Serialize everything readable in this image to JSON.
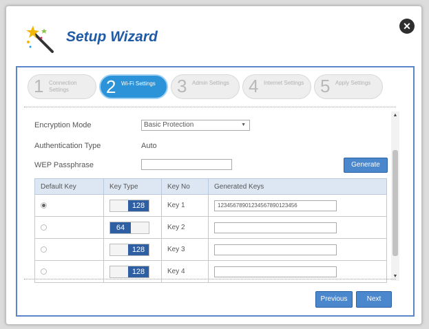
{
  "header": {
    "title": "Setup Wizard",
    "close_symbol": "✕"
  },
  "steps": [
    {
      "num": "1",
      "label": "Connection Settings",
      "active": false
    },
    {
      "num": "2",
      "label": "Wi-Fi Settings",
      "active": true
    },
    {
      "num": "3",
      "label": "Admin Settings",
      "active": false
    },
    {
      "num": "4",
      "label": "Internet Settings",
      "active": false
    },
    {
      "num": "5",
      "label": "Apply Settings",
      "active": false
    }
  ],
  "form": {
    "encryption_label": "Encryption Mode",
    "encryption_value": "Basic Protection",
    "auth_label": "Authentication Type",
    "auth_value": "Auto",
    "wep_label": "WEP Passphrase",
    "generate_label": "Generate"
  },
  "table": {
    "headers": [
      "Default Key",
      "Key Type",
      "Key No",
      "Generated Keys"
    ],
    "rows": [
      {
        "default": true,
        "key_type": "128",
        "key_no": "Key 1",
        "generated": "12345678901234567890123456"
      },
      {
        "default": false,
        "key_type": "64",
        "key_no": "Key 2",
        "generated": ""
      },
      {
        "default": false,
        "key_type": "128",
        "key_no": "Key 3",
        "generated": ""
      },
      {
        "default": false,
        "key_type": "128",
        "key_no": "Key 4",
        "generated": ""
      }
    ]
  },
  "nav": {
    "previous_label": "Previous",
    "next_label": "Next"
  }
}
